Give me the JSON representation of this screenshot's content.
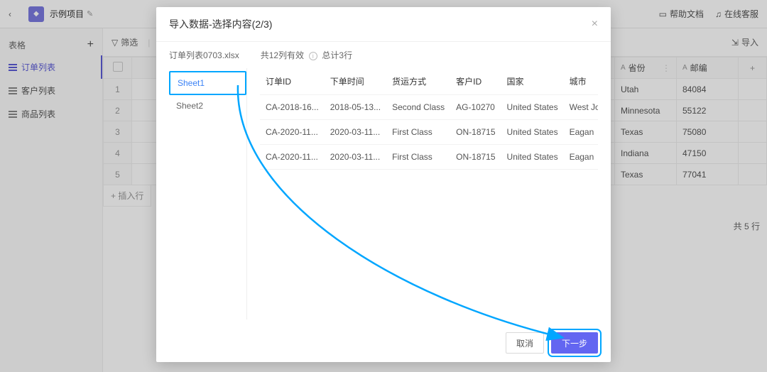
{
  "topbar": {
    "project_name": "示例项目",
    "help_docs": "帮助文档",
    "online_service": "在线客服"
  },
  "sidebar": {
    "header": "表格",
    "items": [
      {
        "label": "订单列表"
      },
      {
        "label": "客户列表"
      },
      {
        "label": "商品列表"
      }
    ]
  },
  "toolbar": {
    "filter_label": "筛选",
    "import_label": "导入"
  },
  "bg_table": {
    "columns": [
      {
        "label": "省份",
        "type": "A"
      },
      {
        "label": "邮编",
        "type": "A"
      }
    ],
    "bg_left_placeholder_label": "1",
    "insert_row_label": "+ 插入行",
    "rows": [
      {
        "c0": "Utah",
        "c1": "84084"
      },
      {
        "c0": "Minnesota",
        "c1": "55122"
      },
      {
        "c0": "Texas",
        "c1": "75080"
      },
      {
        "c0": "Indiana",
        "c1": "47150"
      },
      {
        "c0": "Texas",
        "c1": "77041"
      }
    ],
    "row_count_label": "共 5 行"
  },
  "modal": {
    "title": "导入数据-选择内容(2/3)",
    "file_name": "订单列表0703.xlsx",
    "summary_cols": "共12列有效",
    "summary_rows": "总计3行",
    "sheets": [
      {
        "name": "Sheet1"
      },
      {
        "name": "Sheet2"
      }
    ],
    "preview": {
      "columns": [
        "订单ID",
        "下单时间",
        "货运方式",
        "客户ID",
        "国家",
        "城市"
      ],
      "rows": [
        [
          "CA-2018-16...",
          "2018-05-13...",
          "Second Class",
          "AG-10270",
          "United States",
          "West Jor..."
        ],
        [
          "CA-2020-11...",
          "2020-03-11...",
          "First Class",
          "ON-18715",
          "United States",
          "Eagan"
        ],
        [
          "CA-2020-11...",
          "2020-03-11...",
          "First Class",
          "ON-18715",
          "United States",
          "Eagan"
        ]
      ]
    },
    "cancel_label": "取消",
    "next_label": "下一步"
  }
}
